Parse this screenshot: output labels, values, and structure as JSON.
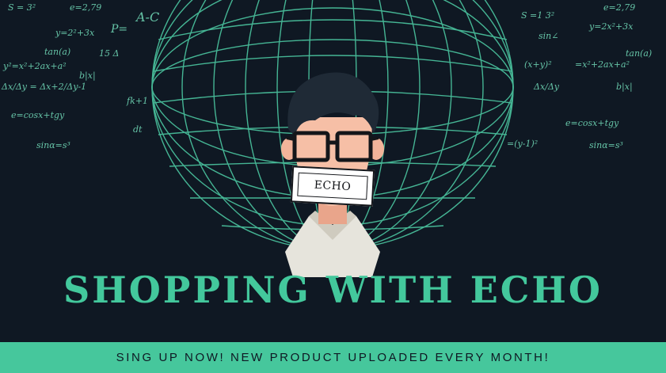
{
  "banner": {
    "headline": "SHOPPING WITH ECHO",
    "mask_label": "ECHO",
    "cta": "SING UP NOW! NEW PRODUCT UPLOADED EVERY MONTH!"
  },
  "colors": {
    "background": "#0f1823",
    "accent": "#43c89c",
    "cta_bar": "#46c79c"
  },
  "math_decoration": {
    "left": [
      "S = 3²",
      "e=2,79",
      "P=",
      "A-C",
      "y=2²+3x",
      "tan(a)",
      "15 Δ",
      "y²=x²+2ax+a²",
      "Δx/Δy = Δx+2/Δy-1",
      "b|x|",
      "e=cosx+tgy",
      "sinα=s³",
      "fk+1",
      "dt"
    ],
    "right": [
      "S =1 3²",
      "e=2,79",
      "y=2x²+3x",
      "sin∠",
      "tan(a)",
      "(x+y)²",
      "=x²+2ax+a²",
      "Δx/Δy",
      "b|x|",
      "e=cosx+tgy",
      "sinα=s³",
      "=(y-1)²"
    ]
  }
}
